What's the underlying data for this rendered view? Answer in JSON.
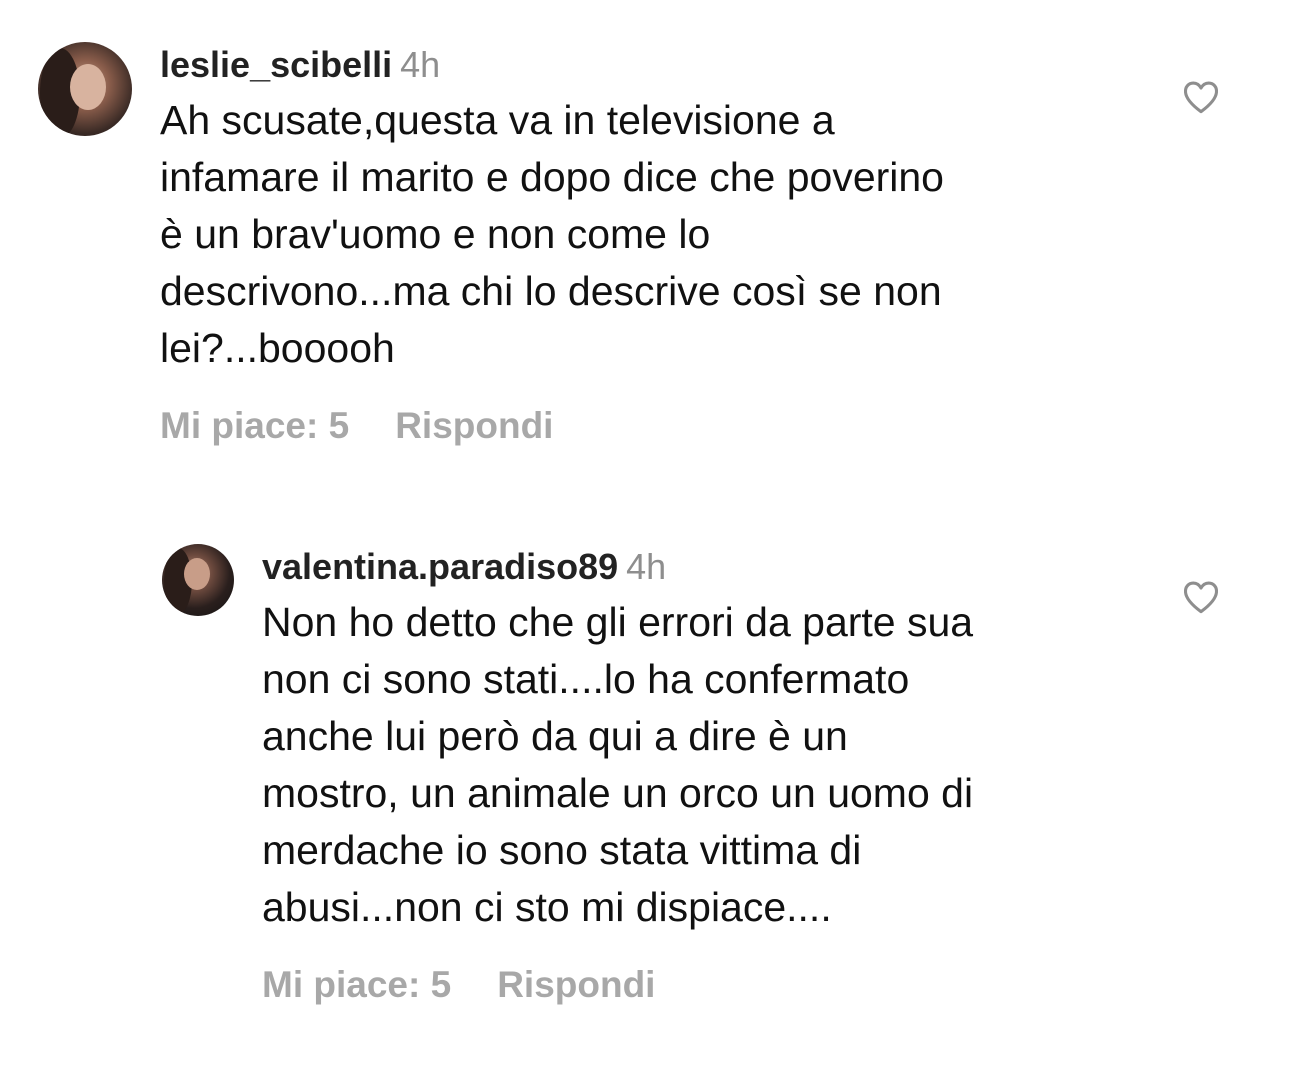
{
  "comments": [
    {
      "username": "leslie_scibelli",
      "time": "4h",
      "text_lines": [
        "Ah scusate,questa va in televisione a",
        "infamare il marito e dopo dice che poverino",
        "è un brav'uomo e non come lo",
        "descrivono...ma chi lo descrive così se non",
        "lei?...booooh"
      ],
      "likes_label": "Mi piace: 5",
      "reply_label": "Rispondi",
      "like_icon": "heart-outline-icon"
    },
    {
      "username": "valentina.paradiso89",
      "time": "4h",
      "text_lines": [
        "Non ho detto che gli errori da parte sua",
        "non ci sono stati....lo ha confermato",
        "anche lui però da qui a dire è un",
        "mostro, un animale un orco un uomo di",
        "merdache io sono stata vittima di",
        "abusi...non ci sto mi dispiace...."
      ],
      "likes_label": "Mi piace: 5",
      "reply_label": "Rispondi",
      "like_icon": "heart-outline-icon"
    }
  ],
  "colors": {
    "text": "#111111",
    "secondary": "#8e8e8e",
    "action": "#a8a8a8"
  }
}
